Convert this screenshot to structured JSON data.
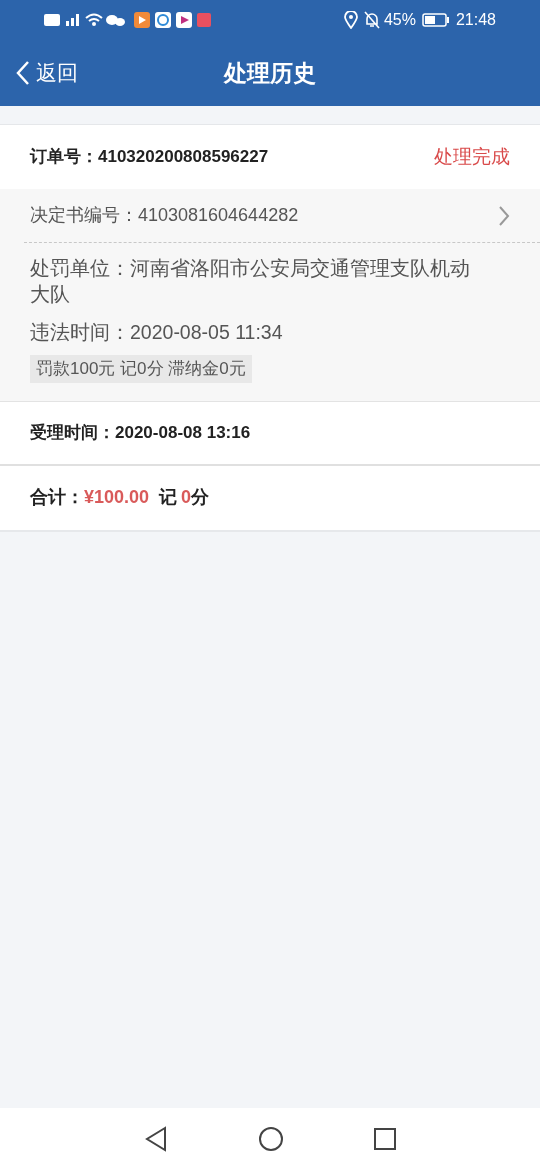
{
  "status_bar": {
    "battery_percent": "45%",
    "time": "21:48"
  },
  "header": {
    "back": "返回",
    "title": "处理历史"
  },
  "order": {
    "label": "订单号：",
    "number": "410320200808596227",
    "status": "处理完成"
  },
  "decision": {
    "label": "决定书编号：",
    "number": "4103081604644282"
  },
  "details": [
    {
      "label": "处罚单位：",
      "value": "河南省洛阳市公安局交通管理支队机动大队"
    },
    {
      "label": "违法时间：",
      "value": "2020-08-05 11:34"
    }
  ],
  "penalty_tag": "罚款100元 记0分 滞纳金0元",
  "received": {
    "label": "受理时间：",
    "value": "2020-08-08 13:16"
  },
  "total": {
    "label": "合计：",
    "amount": "¥100.00",
    "points_prefix": "记",
    "points": "0",
    "points_suffix": "分"
  }
}
